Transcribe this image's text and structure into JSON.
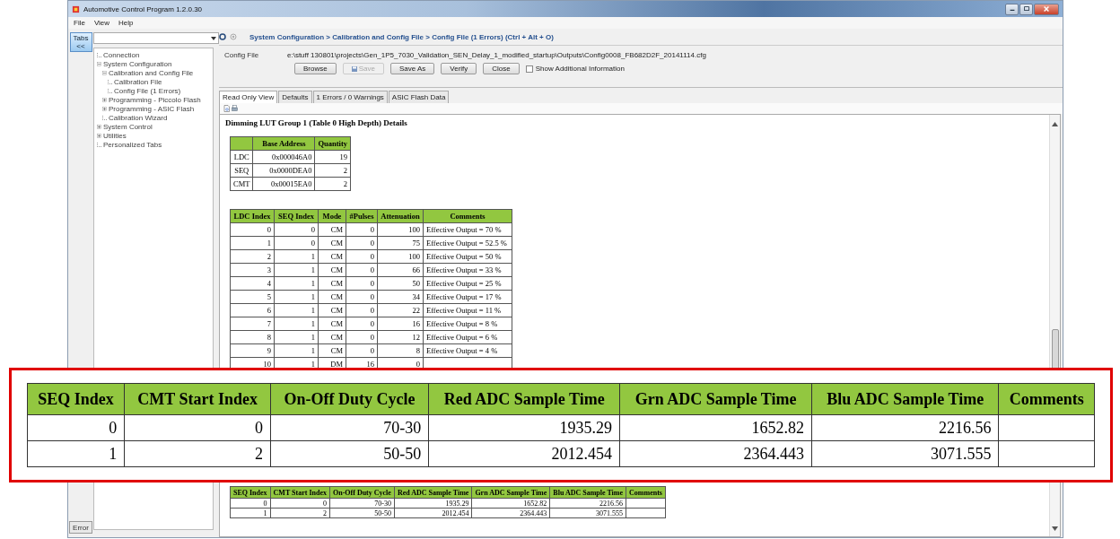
{
  "window": {
    "title": "Automotive Control Program 1.2.0.30"
  },
  "menu": [
    "File",
    "View",
    "Help"
  ],
  "side_tab": {
    "label": "Tabs <<"
  },
  "sidebar": {
    "items": [
      {
        "label": "Connection"
      },
      {
        "label": "System Configuration",
        "expanded": true,
        "children": [
          {
            "label": "Calibration and Config File",
            "expanded": true,
            "children": [
              {
                "label": "Calibration File"
              },
              {
                "label": "Config File (1 Errors)"
              }
            ]
          },
          {
            "label": "Programming - Piccolo Flash",
            "expanded": false
          },
          {
            "label": "Programming - ASIC Flash",
            "expanded": false
          },
          {
            "label": "Calibration Wizard"
          }
        ]
      },
      {
        "label": "System Control",
        "expanded": false
      },
      {
        "label": "Utilities",
        "expanded": false
      },
      {
        "label": "Personalized Tabs"
      }
    ]
  },
  "error_button": "Error",
  "breadcrumb": "System Configuration > Calibration and Config File > Config File (1 Errors) (Ctrl + Alt + O)",
  "config": {
    "label": "Config File",
    "path": "e:\\stuff 130801\\projects\\Gen_1P5_7030_Validation_SEN_Delay_1_modified_startup\\Outputs\\Config0008_FB682D2F_20141114.cfg",
    "buttons": [
      {
        "label": "Browse",
        "disabled": false
      },
      {
        "label": "Save",
        "disabled": true
      },
      {
        "label": "Save As",
        "disabled": false
      },
      {
        "label": "Verify",
        "disabled": false
      },
      {
        "label": "Close",
        "disabled": false
      }
    ],
    "checkbox": {
      "label": "Show Additional Information",
      "checked": false
    }
  },
  "tabs": [
    {
      "label": "Read Only View",
      "selected": true
    },
    {
      "label": "Defaults",
      "selected": false
    },
    {
      "label": "1 Errors / 0 Warnings",
      "selected": false
    },
    {
      "label": "ASIC Flash Data",
      "selected": false
    }
  ],
  "heading": "Dimming LUT Group 1 (Table 0 High Depth) Details",
  "address_table": {
    "columns": [
      "",
      "Base Address",
      "Quantity"
    ],
    "rows": [
      [
        "LDC",
        "0x000046A0",
        "19"
      ],
      [
        "SEQ",
        "0x0000DEA0",
        "2"
      ],
      [
        "CMT",
        "0x00015EA0",
        "2"
      ]
    ]
  },
  "ldc_table": {
    "columns": [
      "LDC Index",
      "SEQ Index",
      "Mode",
      "#Pulses",
      "Attenuation",
      "Comments"
    ],
    "rows": [
      [
        "0",
        "0",
        "CM",
        "0",
        "100",
        "Effective Output = 70 %"
      ],
      [
        "1",
        "0",
        "CM",
        "0",
        "75",
        "Effective Output = 52.5 %"
      ],
      [
        "2",
        "1",
        "CM",
        "0",
        "100",
        "Effective Output = 50 %"
      ],
      [
        "3",
        "1",
        "CM",
        "0",
        "66",
        "Effective Output = 33 %"
      ],
      [
        "4",
        "1",
        "CM",
        "0",
        "50",
        "Effective Output = 25 %"
      ],
      [
        "5",
        "1",
        "CM",
        "0",
        "34",
        "Effective Output = 17 %"
      ],
      [
        "6",
        "1",
        "CM",
        "0",
        "22",
        "Effective Output = 11 %"
      ],
      [
        "7",
        "1",
        "CM",
        "0",
        "16",
        "Effective Output = 8 %"
      ],
      [
        "8",
        "1",
        "CM",
        "0",
        "12",
        "Effective Output = 6 %"
      ],
      [
        "9",
        "1",
        "CM",
        "0",
        "8",
        "Effective Output = 4 %"
      ],
      [
        "10",
        "1",
        "DM",
        "16",
        "0",
        ""
      ]
    ]
  },
  "seq_table": {
    "columns": [
      "SEQ Index",
      "CMT Start Index",
      "On-Off Duty Cycle",
      "Red ADC Sample Time",
      "Grn ADC Sample Time",
      "Blu ADC Sample Time",
      "Comments"
    ],
    "rows": [
      [
        "0",
        "0",
        "70-30",
        "1935.29",
        "1652.82",
        "2216.56",
        ""
      ],
      [
        "1",
        "2",
        "50-50",
        "2012.454",
        "2364.443",
        "3071.555",
        ""
      ]
    ]
  },
  "callout_table": {
    "columns": [
      "SEQ Index",
      "CMT Start Index",
      "On-Off Duty Cycle",
      "Red ADC Sample Time",
      "Grn ADC Sample Time",
      "Blu ADC Sample Time",
      "Comments"
    ],
    "rows": [
      [
        "0",
        "0",
        "70-30",
        "1935.29",
        "1652.82",
        "2216.56",
        ""
      ],
      [
        "1",
        "2",
        "50-50",
        "2012.454",
        "2364.443",
        "3071.555",
        ""
      ]
    ]
  }
}
